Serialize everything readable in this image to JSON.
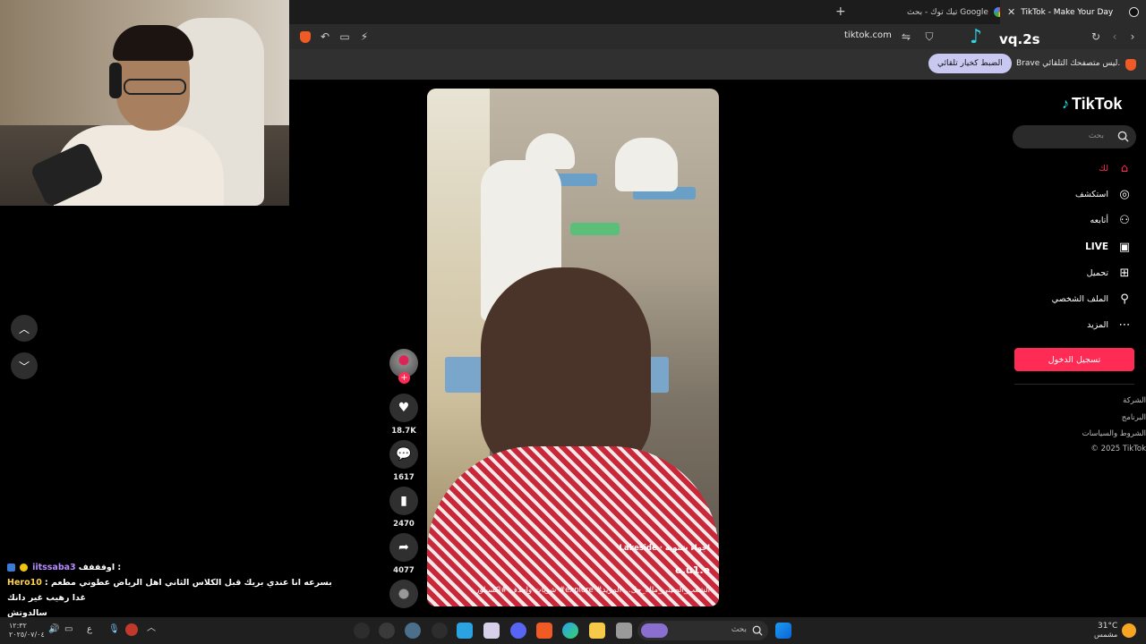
{
  "browser": {
    "tabs": [
      {
        "title": "TikTok - Make Your Day",
        "active": true
      },
      {
        "title": "تيك توك - بحث Google",
        "active": false
      }
    ],
    "address": "tiktok.com",
    "infobar": {
      "message": "Brave ليس متصفحك التلقائي.",
      "button": "الضبط كخيار تلقائي"
    },
    "overlay_handle": "vq.2s"
  },
  "chat": {
    "line1_user": "iitssaba3",
    "line1_msg": "اوفففف :",
    "line2_user": "Hero10",
    "line2_msg": ": بسرعه انا عندي بريك قبل الكلاس الثاني اهل الرياض عطوني مطعم غدا رهيب غير دانك",
    "line3_msg": "سالدوتش"
  },
  "video": {
    "sound": "Lakeside · اجواء شتوية",
    "author": "o.u1.e",
    "description": "شويات واحذف #اكسبلور #explore #الشعب_الصيني_ماله_حل... المزيد"
  },
  "actions": {
    "likes": "18.7K",
    "comments": "1617",
    "saves": "2470",
    "shares": "4077"
  },
  "sidebar": {
    "logo": "TikTok",
    "search_placeholder": "بحث",
    "nav": [
      {
        "label": "لك",
        "icon": "home-icon"
      },
      {
        "label": "استكشف",
        "icon": "compass-icon"
      },
      {
        "label": "أتابعه",
        "icon": "following-icon"
      },
      {
        "label": "LIVE",
        "icon": "live-icon"
      },
      {
        "label": "تحميل",
        "icon": "upload-icon"
      },
      {
        "label": "الملف الشخصي",
        "icon": "profile-icon"
      },
      {
        "label": "المزيد",
        "icon": "more-icon"
      }
    ],
    "login_button": "تسجيل الدخول",
    "footer": [
      "الشركة",
      "البرنامج",
      "الشروط والسياسات",
      "© 2025 TikTok"
    ]
  },
  "taskbar": {
    "search_placeholder": "بحث",
    "weather_temp": "31°C",
    "weather_desc": "مشمس",
    "time": "١٢:٣٢",
    "date": "٢٠٢٥/٠٧/٠٤",
    "lang": "ع"
  },
  "colors": {
    "tiktok_pink": "#fe2c55",
    "chrome_dark": "#2b2b2b",
    "info_button": "#c9c8f0"
  }
}
